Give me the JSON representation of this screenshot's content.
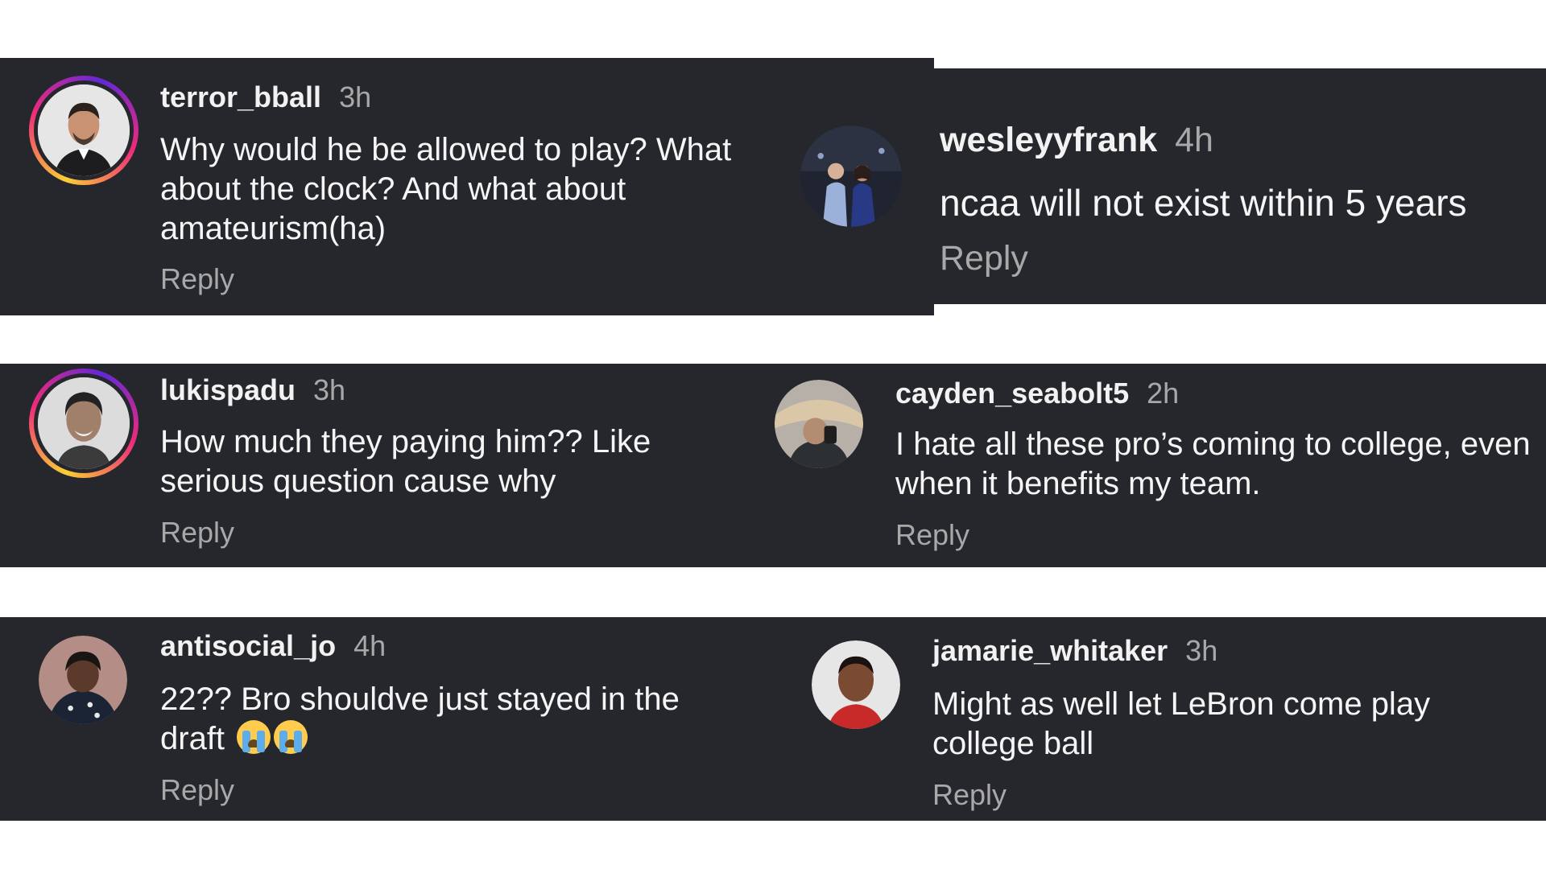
{
  "comments": [
    {
      "username": "terror_bball",
      "time": "3h",
      "text": "Why would he be allowed to play? What about the clock? And what about amateurism(ha)",
      "reply": "Reply"
    },
    {
      "username": "wesleyyfrank",
      "time": "4h",
      "text": "ncaa will not exist within 5 years",
      "reply": "Reply"
    },
    {
      "username": "lukispadu",
      "time": "3h",
      "text": "How much they paying him?? Like serious question cause why",
      "reply": "Reply"
    },
    {
      "username": "cayden_seabolt5",
      "time": "2h",
      "text": "I hate all these pro’s coming to college, even when it benefits my team.",
      "reply": "Reply"
    },
    {
      "username": "antisocial_jo",
      "time": "4h",
      "text": "22?? Bro shouldve just stayed in the draft",
      "emoji": [
        "loudly-crying-face-icon",
        "loudly-crying-face-icon"
      ],
      "reply": "Reply"
    },
    {
      "username": "jamarie_whitaker",
      "time": "3h",
      "text": "Might as well let LeBron come play college ball",
      "reply": "Reply"
    }
  ],
  "colors": {
    "panel_background": "#25272c",
    "username": "#f2f2f2",
    "secondary_text": "#a8a8a8",
    "story_ring": [
      "#f9ce34",
      "#ee2a7b",
      "#6228d7"
    ]
  }
}
